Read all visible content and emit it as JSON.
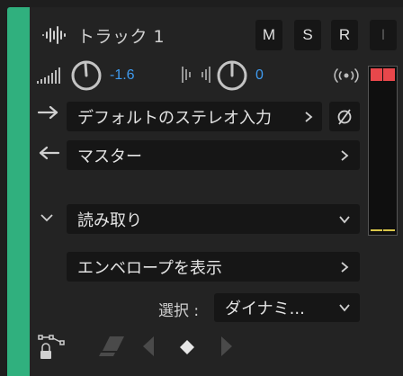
{
  "track": {
    "name": "トラック 1",
    "color": "#30b07e",
    "mute_label": "M",
    "solo_label": "S",
    "record_label": "R",
    "input_monitor_label": "I"
  },
  "volume": {
    "value": "-1.6"
  },
  "pan": {
    "value": "0"
  },
  "input": {
    "value": "デフォルトのステレオ入力"
  },
  "output": {
    "value": "マスター"
  },
  "automation": {
    "mode": "読み取り",
    "show_envelopes_label": "エンベロープを表示",
    "select_label": "選択 :",
    "select_value": "ダイナミ..."
  },
  "colors": {
    "accent_blue": "#3f9bf0",
    "clip_red": "#e8474b",
    "meter_yellow": "#d9c64a"
  }
}
